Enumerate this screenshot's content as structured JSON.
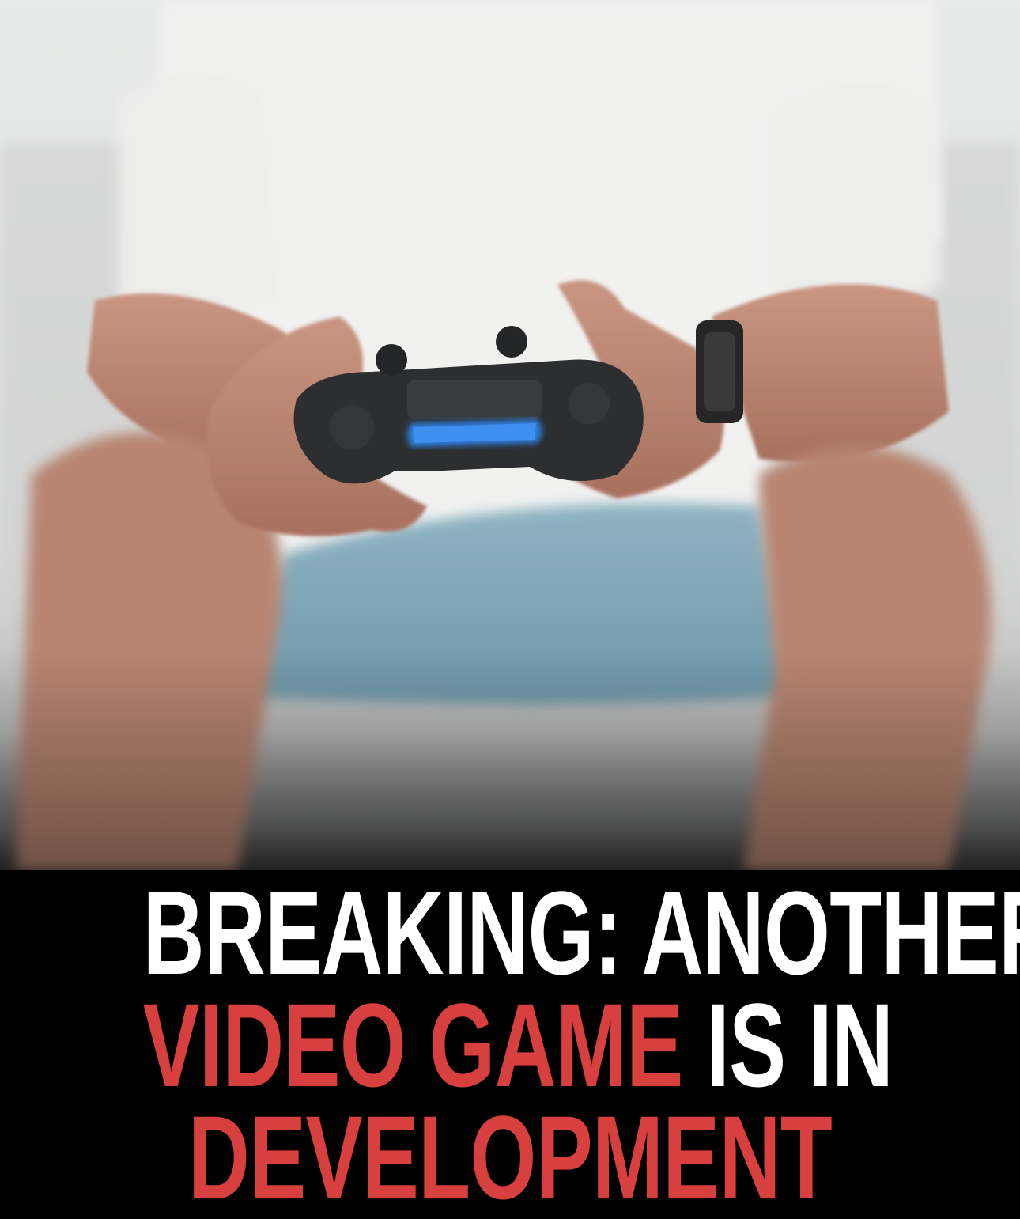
{
  "headline": {
    "line1": "BREAKING: ANOTHER",
    "line2_red": "VIDEO GAME",
    "line2_white": "IS IN",
    "line3_red": "DEVELOPMENT"
  },
  "colors": {
    "highlight": "#d8403f",
    "text": "#ffffff",
    "background": "#000000",
    "controller_light": "#2f7fe0"
  },
  "image": {
    "subject": "person-holding-game-controller"
  }
}
